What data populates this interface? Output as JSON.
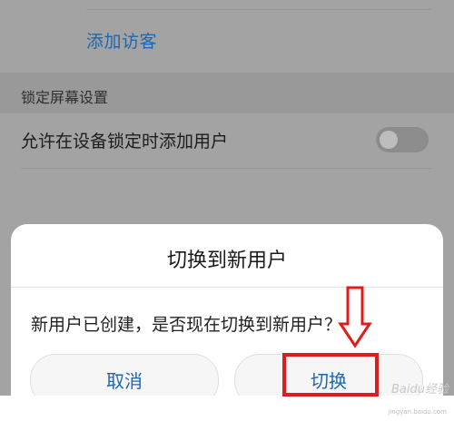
{
  "settings": {
    "add_guest_label": "添加访客",
    "lock_screen_section_title": "锁定屏幕设置",
    "allow_add_user_when_locked_label": "允许在设备锁定时添加用户",
    "allow_add_user_when_locked_enabled": false
  },
  "dialog": {
    "title": "切换到新用户",
    "message": "新用户已创建，是否现在切换到新用户？",
    "cancel_label": "取消",
    "switch_label": "切换"
  },
  "annotation": {
    "highlight_color": "#e01b1b"
  },
  "watermark": {
    "text": "Baidu经验",
    "sub": "jingyan.baidu.com"
  }
}
